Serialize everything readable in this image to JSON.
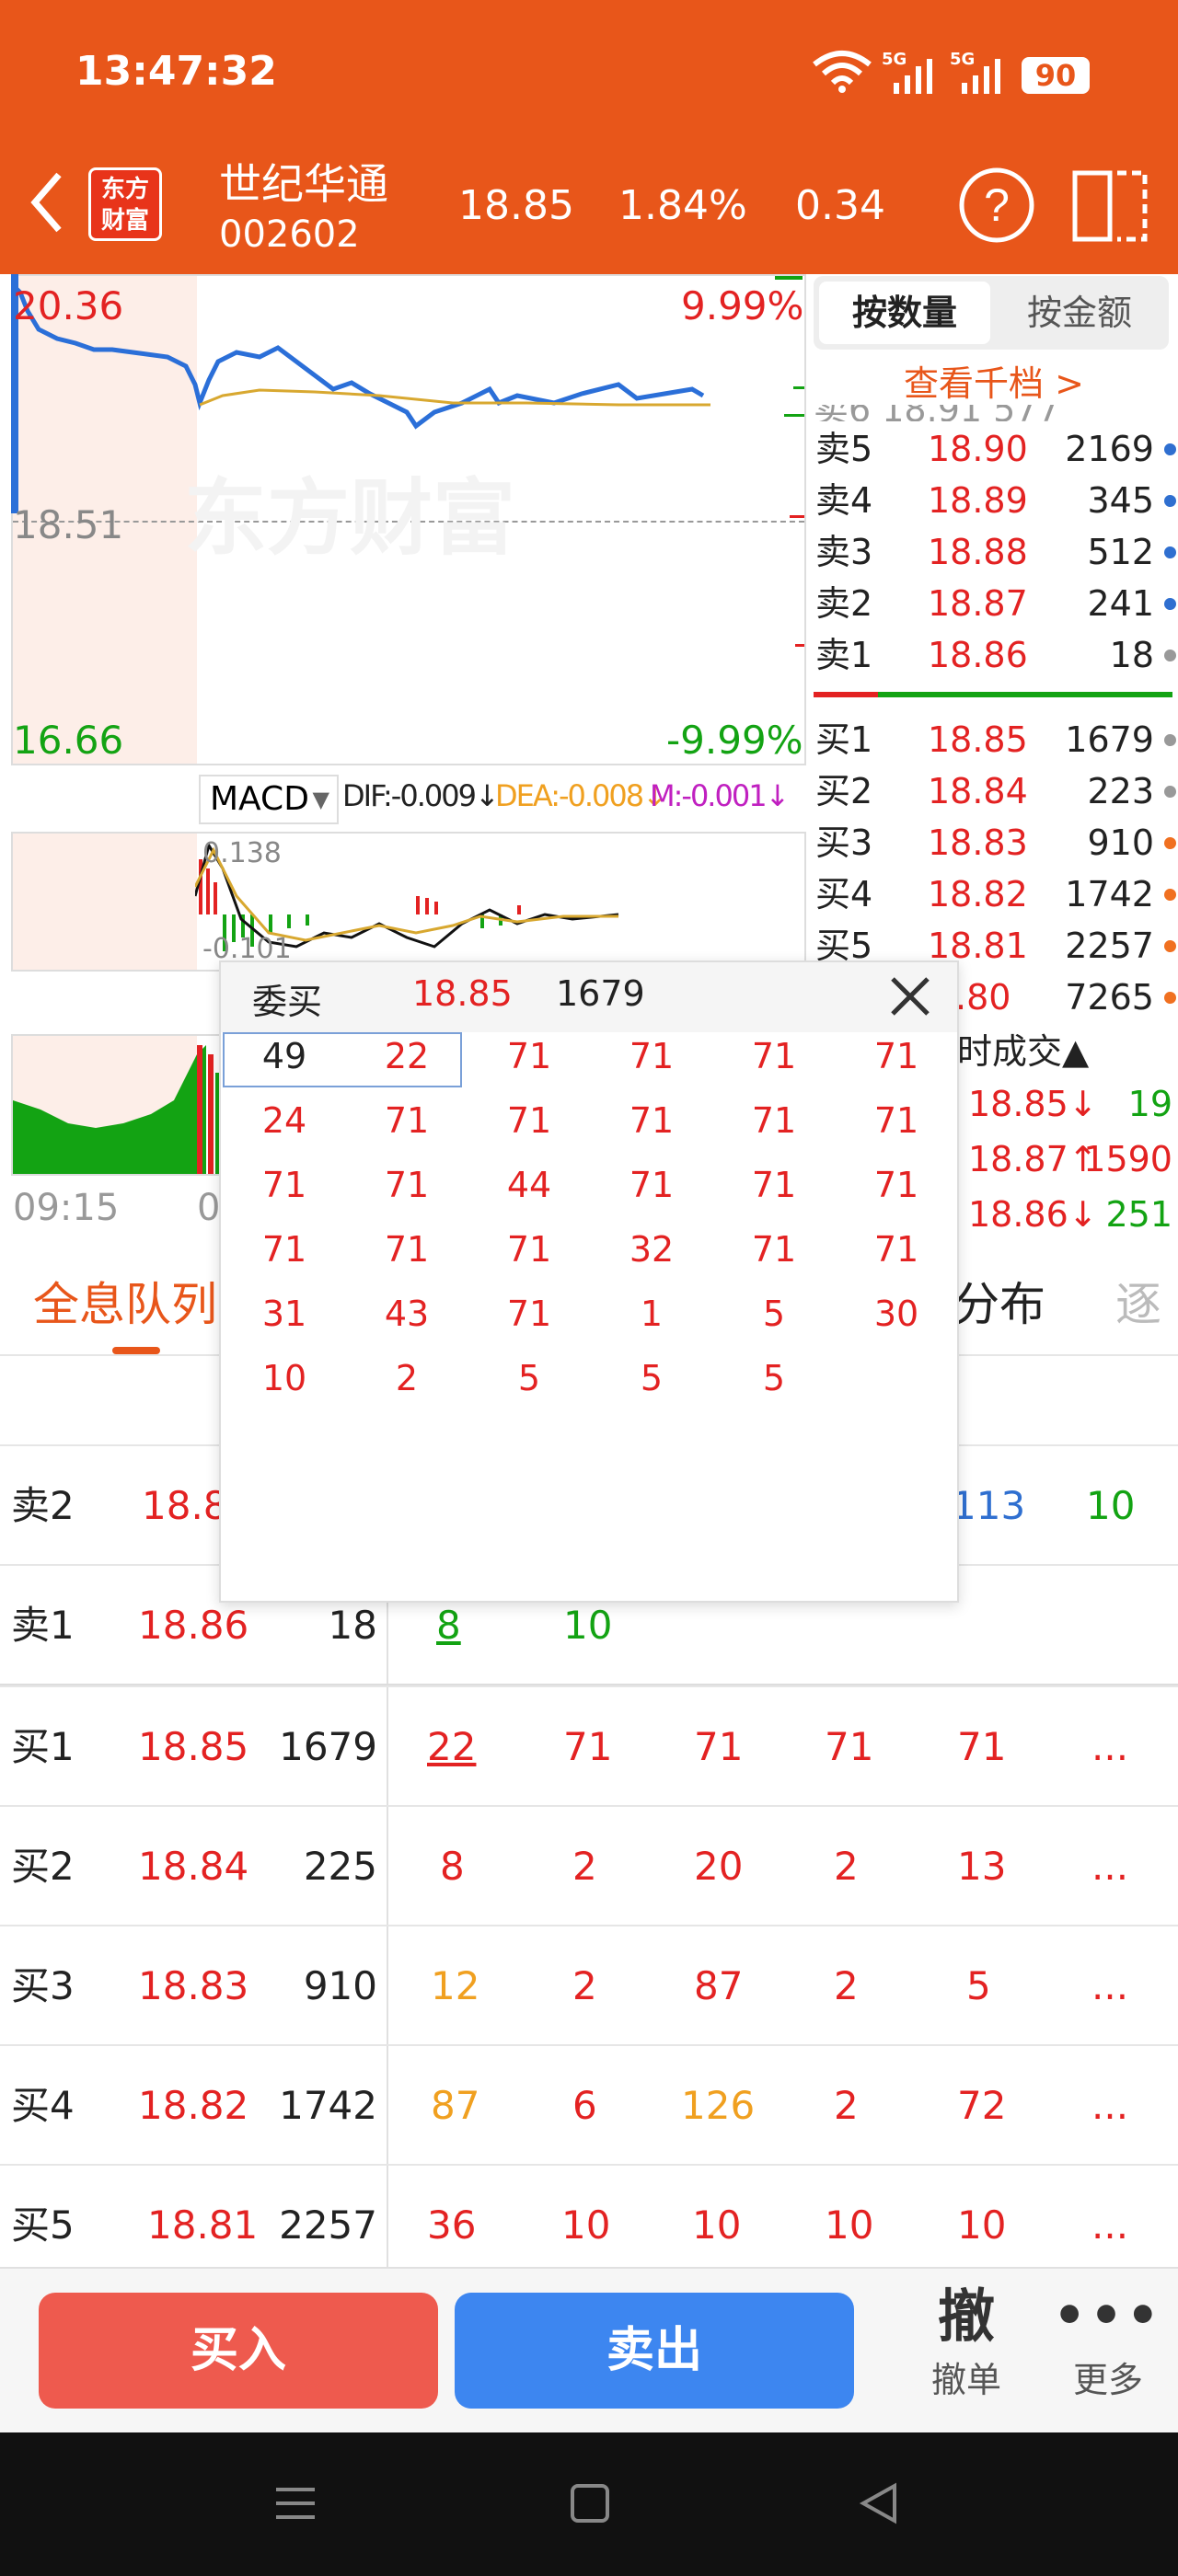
{
  "status": {
    "time": "13:47:32",
    "sig1": "5G",
    "sig2": "5G",
    "battery": "90"
  },
  "header": {
    "logo_top": "东方",
    "logo_bottom": "财富",
    "name": "世纪华通",
    "code": "002602",
    "price": "18.85",
    "pct": "1.84%",
    "change": "0.34"
  },
  "chart": {
    "high_price": "20.36",
    "high_pct": "9.99%",
    "low_price": "16.66",
    "low_pct": "-9.99%",
    "base": "18.51",
    "watermark": "东方财富",
    "time_start": "09:15",
    "time_partial": "0",
    "macd": {
      "label": "MACD",
      "dif": "DIF:-0.009↓",
      "dea": "DEA:-0.008↓",
      "m": "M:-0.001↓",
      "top": "0.138",
      "bottom": "-0.101"
    }
  },
  "toggle": {
    "qty": "按数量",
    "amt": "按金额",
    "levels": "查看千档 >"
  },
  "orderbook": {
    "sells": [
      {
        "label": "卖5",
        "price": "18.90",
        "vol": "2169",
        "dot": "#2f6fd0"
      },
      {
        "label": "卖4",
        "price": "18.89",
        "vol": "345",
        "dot": "#2f6fd0"
      },
      {
        "label": "卖3",
        "price": "18.88",
        "vol": "512",
        "dot": "#2f6fd0"
      },
      {
        "label": "卖2",
        "price": "18.87",
        "vol": "241",
        "dot": "#2f6fd0"
      },
      {
        "label": "卖1",
        "price": "18.86",
        "vol": "18",
        "dot": "#999999"
      }
    ],
    "buys": [
      {
        "label": "买1",
        "price": "18.85",
        "vol": "1679",
        "dot": "#999999"
      },
      {
        "label": "买2",
        "price": "18.84",
        "vol": "223",
        "dot": "#999999"
      },
      {
        "label": "买3",
        "price": "18.83",
        "vol": "910",
        "dot": "#f07020"
      },
      {
        "label": "买4",
        "price": "18.82",
        "vol": "1742",
        "dot": "#f07020"
      },
      {
        "label": "买5",
        "price": "18.81",
        "vol": "2257",
        "dot": "#f07020"
      },
      {
        "price": ".80",
        "vol": "7265",
        "dot": "#f07020"
      }
    ]
  },
  "trades": {
    "title": "时成交▲",
    "rows": [
      {
        "price": "18.85↓",
        "vol": "19"
      },
      {
        "price": "18.87↑",
        "vol": "1590"
      },
      {
        "price": "18.86↓",
        "vol": "251"
      }
    ]
  },
  "tabs": {
    "tab1": "全息队列",
    "tab3": "分布",
    "tab4": "逐"
  },
  "queue": {
    "sell2": {
      "label": "卖2",
      "price": "18.8",
      "c1": "113",
      "c2": "10"
    },
    "sell1": {
      "label": "卖1",
      "price": "18.86",
      "vol": "18",
      "c1": "8",
      "c2": "10"
    },
    "buys": [
      {
        "label": "买1",
        "price": "18.85",
        "vol": "1679",
        "cells": [
          "22",
          "71",
          "71",
          "71",
          "71"
        ],
        "more": "..."
      },
      {
        "label": "买2",
        "price": "18.84",
        "vol": "225",
        "cells": [
          "8",
          "2",
          "20",
          "2",
          "13"
        ],
        "more": "..."
      },
      {
        "label": "买3",
        "price": "18.83",
        "vol": "910",
        "cells": [
          "12",
          "2",
          "87",
          "2",
          "5"
        ],
        "more": "..."
      },
      {
        "label": "买4",
        "price": "18.82",
        "vol": "1742",
        "cells": [
          "87",
          "6",
          "126",
          "2",
          "72"
        ],
        "more": "..."
      },
      {
        "label": "买5",
        "price": "18.81",
        "vol": "2257",
        "cells": [
          "36",
          "10",
          "10",
          "10",
          "10"
        ],
        "more": "..."
      }
    ]
  },
  "popup": {
    "title": "委买",
    "price": "18.85",
    "vol": "1679",
    "grid": [
      [
        "49",
        "22",
        "71",
        "71",
        "71",
        "71"
      ],
      [
        "24",
        "71",
        "71",
        "71",
        "71",
        "71"
      ],
      [
        "71",
        "71",
        "44",
        "71",
        "71",
        "71"
      ],
      [
        "71",
        "71",
        "71",
        "32",
        "71",
        "71"
      ],
      [
        "31",
        "43",
        "71",
        "1",
        "5",
        "30"
      ],
      [
        "10",
        "2",
        "5",
        "5",
        "5"
      ]
    ]
  },
  "bottom": {
    "buy": "买入",
    "sell": "卖出",
    "cancel_icon": "撤",
    "cancel": "撤单",
    "more": "更多"
  }
}
